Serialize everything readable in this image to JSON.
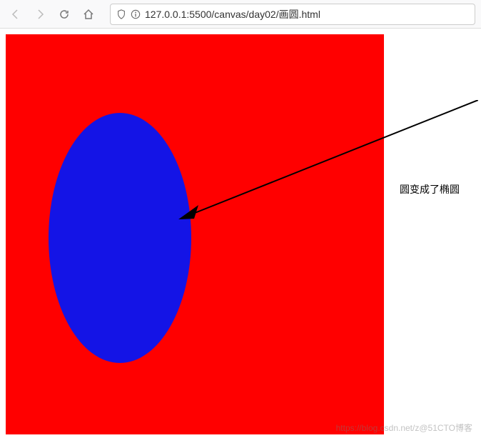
{
  "toolbar": {
    "back_icon": "back",
    "forward_icon": "forward",
    "reload_icon": "reload",
    "home_icon": "home"
  },
  "addressbar": {
    "shield_icon": "shield",
    "info_icon": "info",
    "url": "127.0.0.1:5500/canvas/day02/画圆.html"
  },
  "annotation": {
    "label": "圆变成了椭圆"
  },
  "watermark": {
    "text": "https://blog.csdn.net/z@51CTO博客"
  },
  "canvas": {
    "background_color": "#ff0000",
    "shape_type": "ellipse",
    "shape_color": "#1414e6"
  }
}
